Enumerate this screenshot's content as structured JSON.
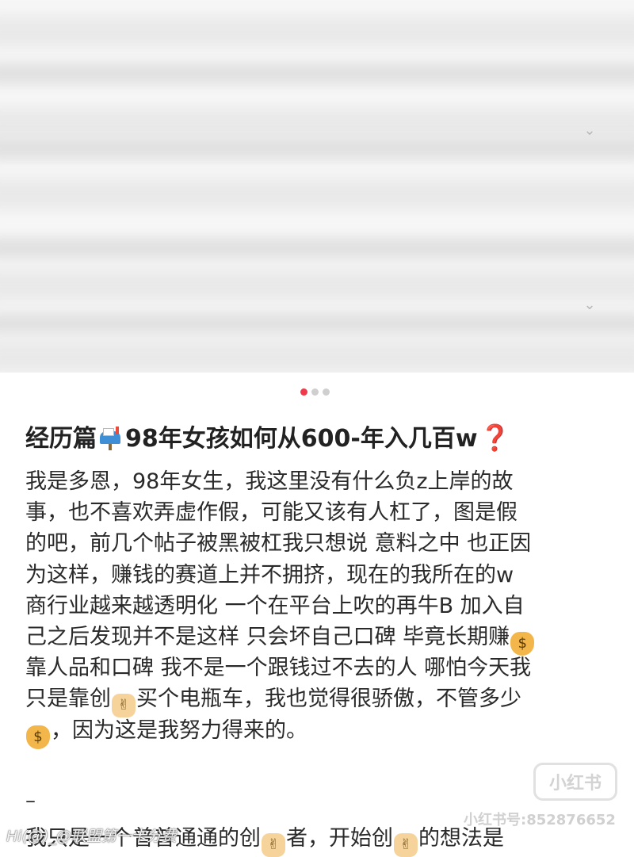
{
  "carousel": {
    "page_count": 3,
    "active_index": 0,
    "active_color": "#ee3a4a",
    "inactive_color": "#cfcfcf"
  },
  "post": {
    "title_text": "经历篇",
    "title_icon": "mailbox-icon",
    "title_text2": "98年女孩如何从600-年入几百w",
    "title_question": "❓",
    "body_lines": [
      "我是多恩，98年女生，我这里没有什么负z上岸的故",
      "事，也不喜欢弄虚作假，可能又该有人杠了，图是假",
      "的吧，前几个帖子被黑被杠我只想说 意料之中 也正因",
      "为这样，赚钱的赛道上并不拥挤，现在的我所在的w",
      "商行业越来越透明化 一个在平台上吹的再牛B 加入自",
      "己之后发现并不是这样 只会坏自己口碑 毕竟长期赚"
    ],
    "line7": "靠人品和口碑 我不是一个跟钱过不去的人 哪怕今天我",
    "line8_a": "只是靠创",
    "line8_b": "买个电瓶车，我也觉得很骄傲，不管多少",
    "line9": "，因为这是我努力得来的。",
    "separator": "–",
    "cut_line_a": "我只是一个普普通通的创",
    "cut_line_b": "者，开始创",
    "cut_line_c": "的想法是"
  },
  "watermark": {
    "logo_text": "小红书",
    "id_text": "小红书号:852876652",
    "source_text": "Hi(@)_@联盟第一卡分费"
  }
}
